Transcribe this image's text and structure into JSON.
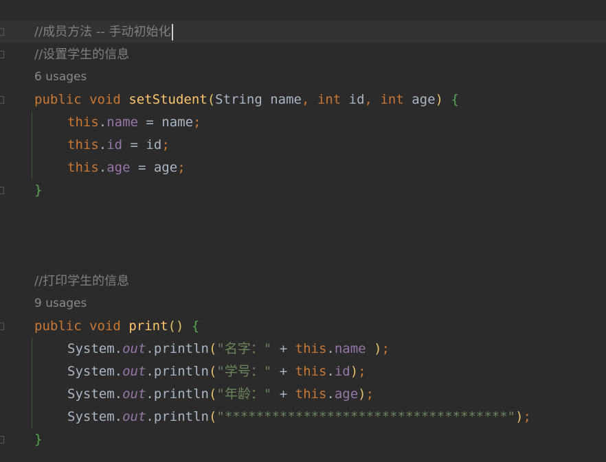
{
  "editor": {
    "block1": {
      "comment_title": "//成员方法 -- 手动初始化",
      "comment_desc": "//设置学生的信息",
      "usages": "6 usages",
      "signature": {
        "modifier": "public",
        "return_type": "void",
        "method_name": "setStudent",
        "open_paren": "(",
        "param1_type": "String",
        "param1_name": " name",
        "comma1": ", ",
        "param2_type": "int",
        "param2_name": " id",
        "comma2": ", ",
        "param3_type": "int",
        "param3_name": " age",
        "close_paren": ")",
        "open_brace": "{"
      },
      "body": [
        {
          "this": "this",
          "dot": ".",
          "field": "name",
          "rest": " = name",
          "semi": ";"
        },
        {
          "this": "this",
          "dot": ".",
          "field": "id",
          "rest": " = id",
          "semi": ";"
        },
        {
          "this": "this",
          "dot": ".",
          "field": "age",
          "rest": " = age",
          "semi": ";"
        }
      ],
      "close_brace": "}"
    },
    "block2": {
      "comment_desc": "//打印学生的信息",
      "usages": "9 usages",
      "signature": {
        "modifier": "public",
        "return_type": "void",
        "method_name": "print",
        "parens": "()",
        "open_brace": "{"
      },
      "body": [
        {
          "cls": "System",
          "dot1": ".",
          "out": "out",
          "dot2": ".",
          "method": "println",
          "lp": "(",
          "str": "\"名字：\"",
          "plus": " + ",
          "this": "this",
          "dot3": ".",
          "field": "name",
          "space": " ",
          "rp": ")",
          "semi": ";"
        },
        {
          "cls": "System",
          "dot1": ".",
          "out": "out",
          "dot2": ".",
          "method": "println",
          "lp": "(",
          "str": "\"学号：\"",
          "plus": " + ",
          "this": "this",
          "dot3": ".",
          "field": "id",
          "space": "",
          "rp": ")",
          "semi": ";"
        },
        {
          "cls": "System",
          "dot1": ".",
          "out": "out",
          "dot2": ".",
          "method": "println",
          "lp": "(",
          "str": "\"年龄：\"",
          "plus": " + ",
          "this": "this",
          "dot3": ".",
          "field": "age",
          "space": "",
          "rp": ")",
          "semi": ";"
        },
        {
          "cls": "System",
          "dot1": ".",
          "out": "out",
          "dot2": ".",
          "method": "println",
          "lp": "(",
          "str": "\"************************************\"",
          "plus": "",
          "this": "",
          "dot3": "",
          "field": "",
          "space": "",
          "rp": ")",
          "semi": ";"
        }
      ],
      "close_brace": "}"
    }
  }
}
